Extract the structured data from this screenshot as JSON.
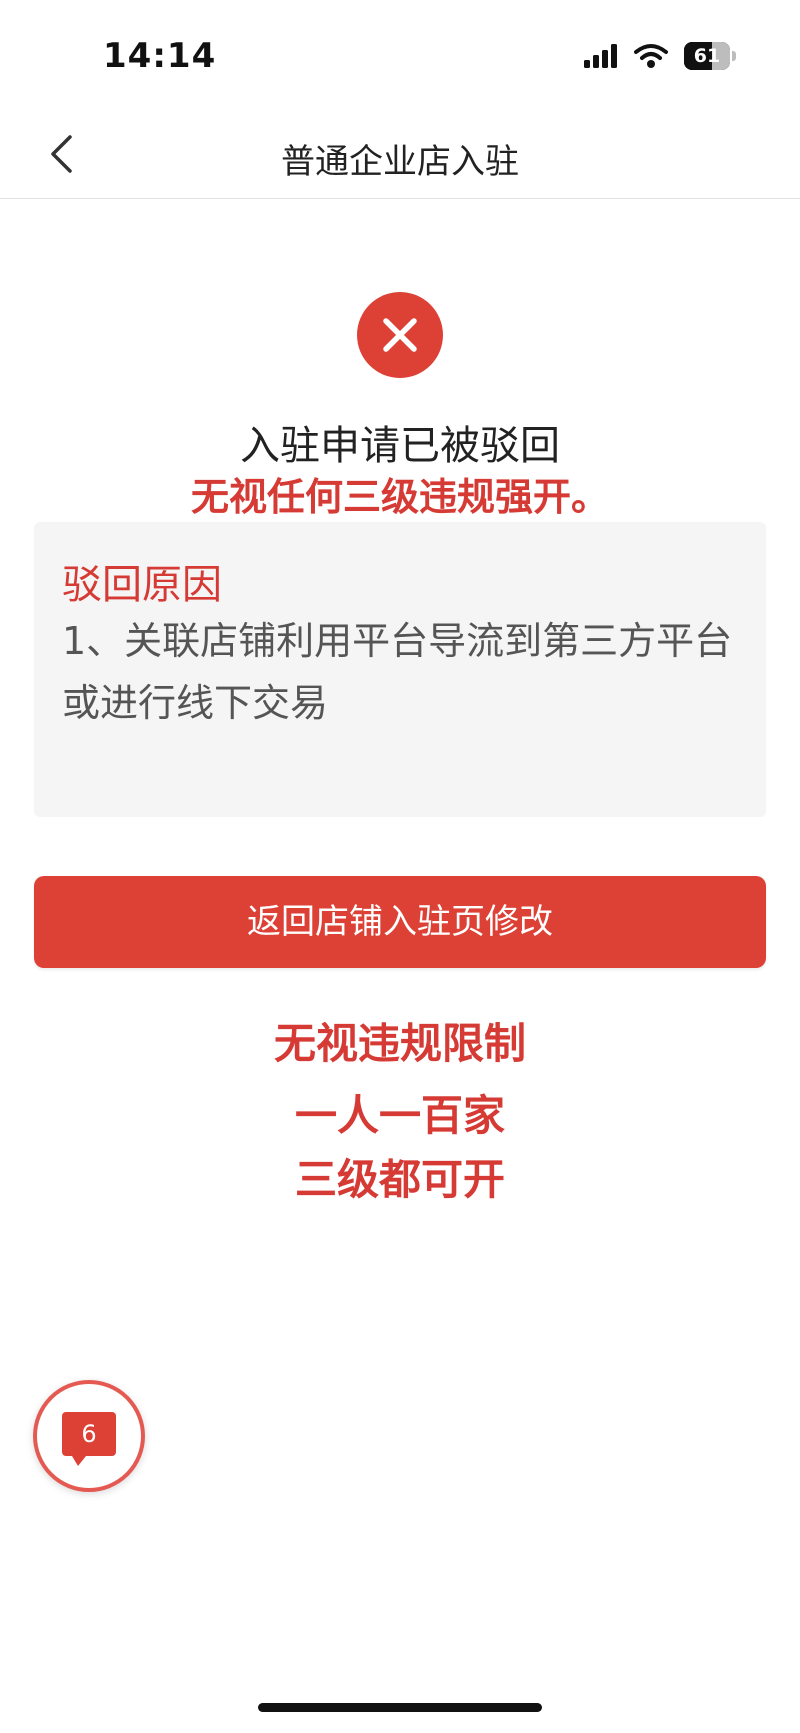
{
  "status_bar": {
    "time": "14:14",
    "battery_percent": "61",
    "battery_level": 0.61,
    "signal_icon": "cellular-signal-icon",
    "wifi_icon": "wifi-icon"
  },
  "nav": {
    "back_icon": "chevron-left-icon",
    "title": "普通企业店入驻"
  },
  "result": {
    "icon": "error-x-icon",
    "title": "入驻申请已被驳回"
  },
  "overlay_caption": "无视任何三级违规强开。",
  "reason": {
    "heading": "驳回原因",
    "text": "1、关联店铺利用平台导流到第三方平台或进行线下交易"
  },
  "actions": {
    "primary_label": "返回店铺入驻页修改"
  },
  "promo": {
    "line1": "无视违规限制",
    "line2": "一人一百家",
    "line3": "三级都可开"
  },
  "message_fab": {
    "icon": "message-bubble-icon",
    "count": "6"
  },
  "colors": {
    "accent": "#dd4136",
    "overlay_text": "#d63a34",
    "panel_bg": "#f5f5f5"
  }
}
